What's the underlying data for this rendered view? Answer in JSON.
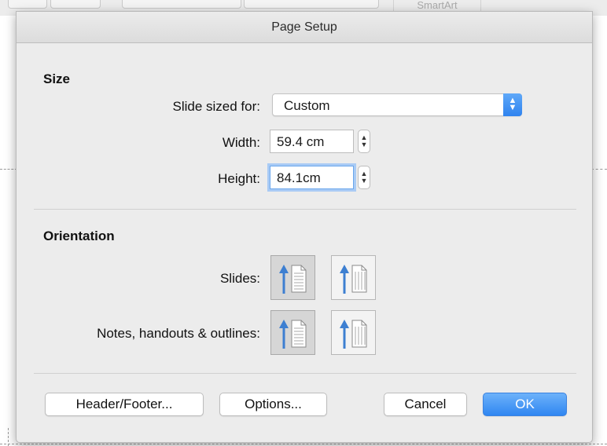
{
  "background": {
    "toolbar_label": "SmartArt"
  },
  "dialog": {
    "title": "Page Setup",
    "size_section": {
      "title": "Size",
      "slide_sized_for": {
        "label": "Slide sized for:",
        "value": "Custom"
      },
      "width": {
        "label": "Width:",
        "value": "59.4 cm"
      },
      "height": {
        "label": "Height:",
        "value": "84.1cm"
      }
    },
    "orientation_section": {
      "title": "Orientation",
      "slides_label": "Slides:",
      "notes_label": "Notes, handouts & outlines:",
      "slides_selected": "portrait",
      "notes_selected": "portrait"
    },
    "buttons": {
      "header_footer": "Header/Footer...",
      "options": "Options...",
      "cancel": "Cancel",
      "ok": "OK"
    },
    "colors": {
      "accent": "#3a8cf3",
      "arrow": "#3d7fd1"
    }
  }
}
